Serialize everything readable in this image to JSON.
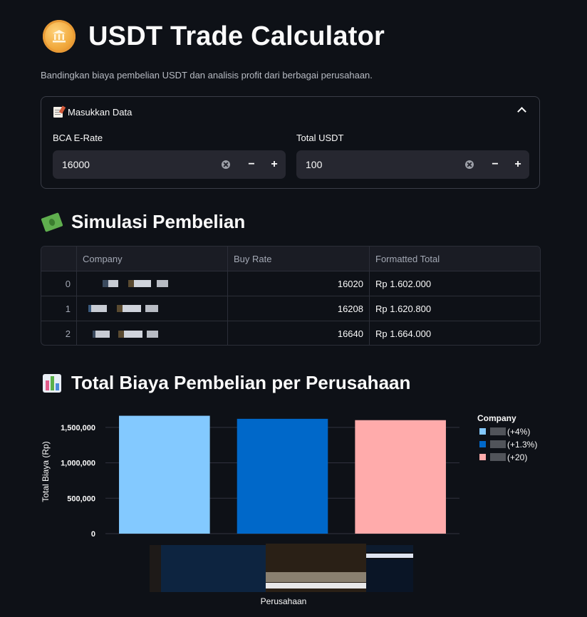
{
  "header": {
    "title": "USDT Trade Calculator",
    "subtitle": "Bandingkan biaya pembelian USDT dan analisis profit dari berbagai perusahaan."
  },
  "input_expander": {
    "title": "Masukkan Data",
    "fields": [
      {
        "label": "BCA E-Rate",
        "value": "16000"
      },
      {
        "label": "Total USDT",
        "value": "100"
      }
    ]
  },
  "simulasi": {
    "title": "Simulasi Pembelian",
    "columns": [
      "",
      "Company",
      "Buy Rate",
      "Formatted Total"
    ],
    "rows": [
      {
        "index": "0",
        "buy_rate": "16020",
        "total": "Rp 1.602.000"
      },
      {
        "index": "1",
        "buy_rate": "16208",
        "total": "Rp 1.620.800"
      },
      {
        "index": "2",
        "buy_rate": "16640",
        "total": "Rp 1.664.000"
      }
    ]
  },
  "chart_section": {
    "title": "Total Biaya Pembelian per Perusahaan"
  },
  "chart_data": {
    "type": "bar",
    "title": "",
    "xlabel": "Perusahaan",
    "ylabel": "Total Biaya (Rp)",
    "ylim": [
      0,
      1750000
    ],
    "yticks": [
      0,
      500000,
      1000000,
      1500000
    ],
    "ytick_labels": [
      "0",
      "500,000",
      "1,000,000",
      "1,500,000"
    ],
    "legend_title": "Company",
    "legend_position": "right",
    "series": [
      {
        "name": "(+4%)",
        "value": 1664000,
        "color": "#83c9ff"
      },
      {
        "name": "(+1.3%)",
        "value": 1620800,
        "color": "#0068c9"
      },
      {
        "name": "(+20)",
        "value": 1602000,
        "color": "#ffabab"
      }
    ]
  }
}
